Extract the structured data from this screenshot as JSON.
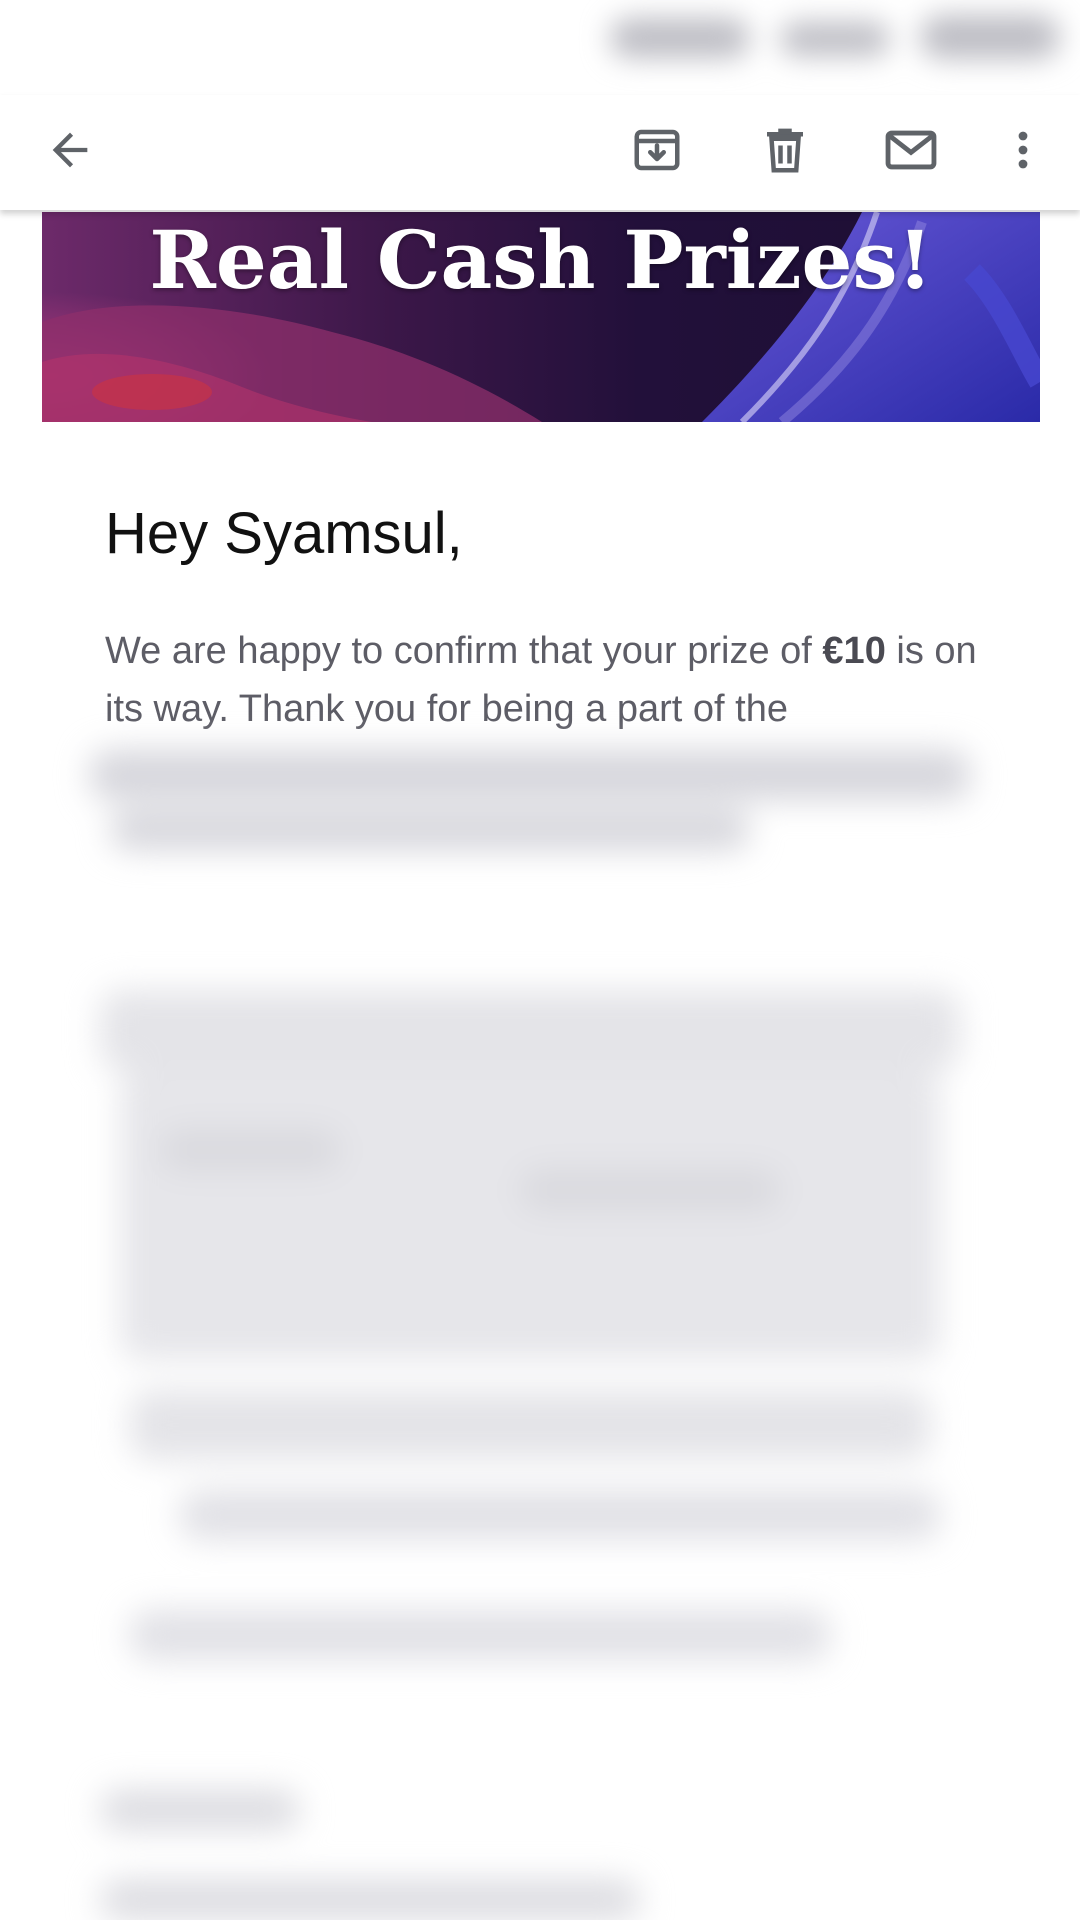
{
  "toolbar": {
    "back": "back-arrow-icon",
    "archive": "archive-icon",
    "delete": "trash-icon",
    "mark_unread": "mail-icon",
    "more": "more-vert-icon"
  },
  "email": {
    "banner_title": "Real Cash Prizes!",
    "greeting": "Hey Syamsul,",
    "body_part1": "We are happy to confirm that your prize of ",
    "prize_amount": "€10",
    "body_part2": " is on its way. Thank you for being a part of the"
  },
  "colors": {
    "banner_bg": "#25113d",
    "icon_gray": "#5f6368",
    "body_text": "#5d5d66"
  }
}
